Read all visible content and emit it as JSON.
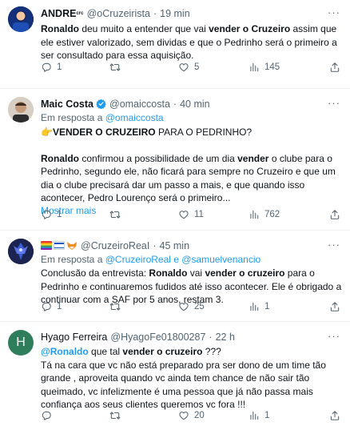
{
  "tweets": [
    {
      "name": "ANDRE",
      "name_suffix": "ᶜʳᶜ",
      "handle": "@oCruzeirista",
      "dot": "·",
      "time": "19 min",
      "body_parts": [
        {
          "text": "Ronaldo",
          "bold": true
        },
        {
          "text": " deu muito a entender que vai ",
          "bold": false
        },
        {
          "text": "vender o Cruzeiro",
          "bold": true
        },
        {
          "text": " assim que ele estiver valorizado, sem dividas e que o Pedrinho será o primeiro a ser consultado para essa aquisição.",
          "bold": false
        }
      ],
      "replies": "1",
      "retweets": "",
      "likes": "5",
      "views": "145"
    },
    {
      "name": "Maic Costa",
      "handle": "@omaiccosta",
      "dot": "·",
      "time": "40 min",
      "reply_prefix": "Em resposta a",
      "reply_to": "@omaiccosta",
      "headline_emoji": "👉",
      "headline_bold": "VENDER O CRUZEIRO",
      "headline_rest": " PARA O PEDRINHO?",
      "body_parts": [
        {
          "text": "Ronaldo",
          "bold": true
        },
        {
          "text": " confirmou a possibilidade de um dia ",
          "bold": false
        },
        {
          "text": "vender",
          "bold": true
        },
        {
          "text": " o clube para o Pedrinho, segundo ele, não ficará para sempre no Cruzeiro e que um dia o clube precisará dar um passo a mais, e que quando isso acontecer, Pedro Lourenço será o primeiro...",
          "bold": false
        }
      ],
      "show_more": "Mostrar mais",
      "replies": "1",
      "retweets": "",
      "likes": "11",
      "views": "762"
    },
    {
      "name": "",
      "handle": "@CruzeiroReaI",
      "dot": "·",
      "time": "45 min",
      "reply_prefix": "Em resposta a",
      "reply_to": "@CruzeiroReal e @samuelvenancio",
      "body_parts": [
        {
          "text": "Conclusão da entrevista: ",
          "bold": false
        },
        {
          "text": "Ronaldo",
          "bold": true
        },
        {
          "text": " vai ",
          "bold": false
        },
        {
          "text": "vender o cruzeiro",
          "bold": true
        },
        {
          "text": " para o Pedrinho e continuaremos fudidos até isso acontecer. Ele é obrigado a continuar com a SAF por 5 anos, restam 3.",
          "bold": false
        }
      ],
      "replies": "1",
      "retweets": "",
      "likes": "25",
      "views": "1"
    },
    {
      "name": "Hyago Ferreira",
      "avatar_letter": "H",
      "handle": "@HyagoFe01800287",
      "dot": "·",
      "time": "22 h",
      "body_parts": [
        {
          "text": "@Ronaldo",
          "bold": true,
          "link": true
        },
        {
          "text": " que tal ",
          "bold": false
        },
        {
          "text": "vender o cruzeiro",
          "bold": true
        },
        {
          "text": " ???\nTá na cara que vc não está preparado pra ser dono de um time tão grande , aproveita quando vc ainda tem chance de não sair tão queimado, vc infelizmente é uma pessoa que já não passa mais confiança aos seus clientes queremos vc fora !!!",
          "bold": false
        }
      ],
      "replies": "",
      "retweets": "",
      "likes": "20",
      "views": "1"
    }
  ],
  "colors": {
    "text": "#0f1419",
    "secondary": "#536471",
    "link": "#1d9bf0",
    "verified": "#1d9bf0",
    "divider": "#eff3f4",
    "hyago_avatar": "#2e7d5b"
  },
  "icons": {
    "reply": "reply-icon",
    "retweet": "retweet-icon",
    "like": "heart-icon",
    "views": "views-icon",
    "share": "share-icon",
    "more": "more-icon"
  },
  "more_glyph": "···"
}
